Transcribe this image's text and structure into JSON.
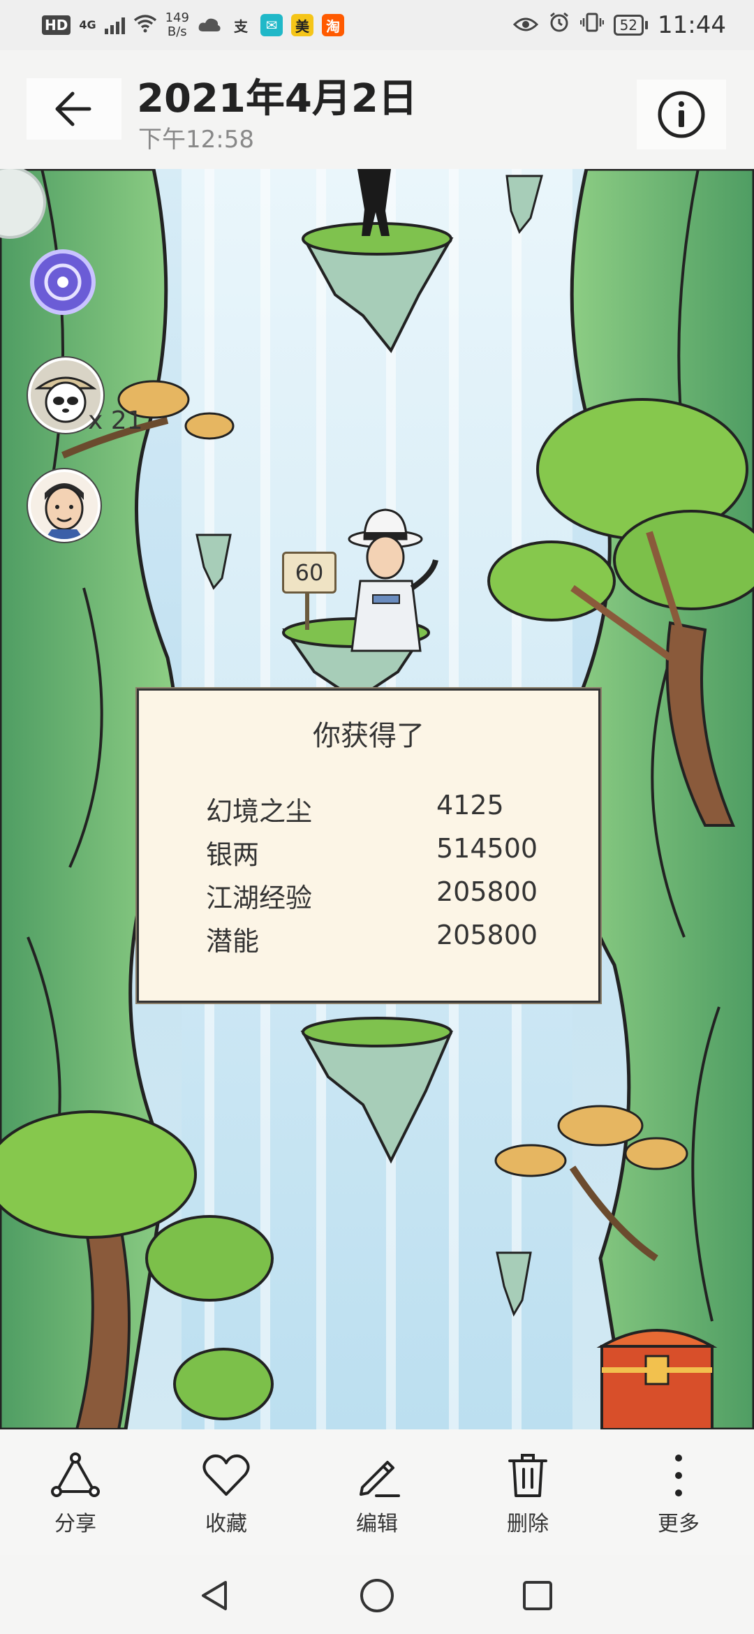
{
  "status_bar": {
    "hd": "HD",
    "network": "4G",
    "speed_value": "149",
    "speed_unit": "B/s",
    "apps": [
      {
        "label": "支",
        "color": "#4c4c4c"
      },
      {
        "label": "✉",
        "color": "#20b8c8"
      },
      {
        "label": "美",
        "color": "#f5c518"
      },
      {
        "label": "淘",
        "color": "#ff5a00"
      }
    ],
    "battery": "52",
    "time": "11:44"
  },
  "header": {
    "title": "2021年4月2日",
    "subtitle": "下午12:58"
  },
  "game": {
    "count_label": "x 21",
    "sign_number": "60",
    "reward_title": "你获得了",
    "rewards": [
      {
        "name": "幻境之尘",
        "value": "4125"
      },
      {
        "name": "银两",
        "value": "514500"
      },
      {
        "name": "江湖经验",
        "value": "205800"
      },
      {
        "name": "潜能",
        "value": "205800"
      }
    ]
  },
  "toolbar": {
    "share": "分享",
    "favorite": "收藏",
    "edit": "编辑",
    "delete": "删除",
    "more": "更多"
  },
  "colors": {
    "accent": "#222222",
    "panel_bg": "#fcf5e6",
    "foliage": "#7cc04a",
    "cliff": "#6fae6a"
  }
}
